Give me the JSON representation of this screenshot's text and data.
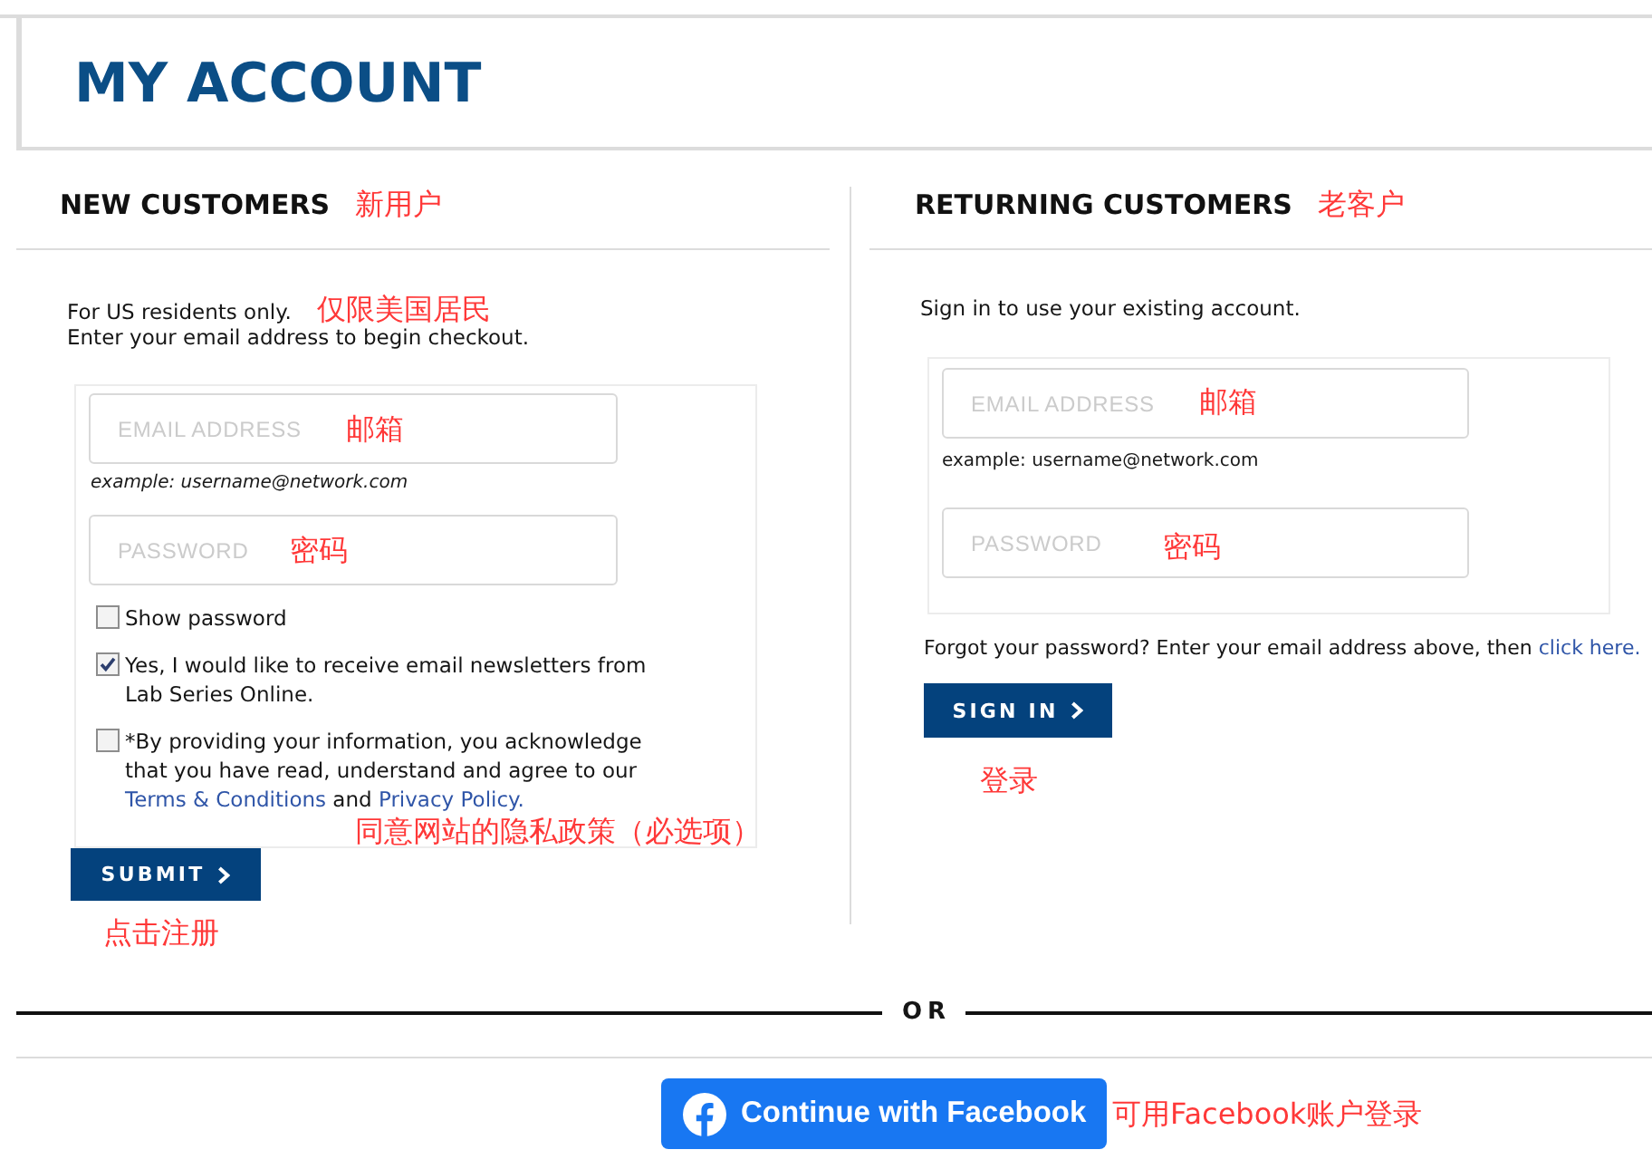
{
  "header": {
    "title": "MY ACCOUNT"
  },
  "new_customers": {
    "heading": "NEW CUSTOMERS",
    "heading_note": "新用户",
    "intro": [
      {
        "text": "For US residents only.",
        "note": "仅限美国居民"
      },
      {
        "text": "Enter your email address to begin checkout."
      }
    ],
    "fields": [
      {
        "placeholder": "EMAIL ADDRESS",
        "note": "邮箱",
        "hint": "example: username@network.com"
      },
      {
        "placeholder": "PASSWORD",
        "note": "密码"
      }
    ],
    "options": [
      {
        "checked": false,
        "label": [
          {
            "kind": "text",
            "text": "Show password"
          }
        ]
      },
      {
        "checked": true,
        "label": [
          {
            "kind": "text",
            "text": "Yes, I would like to receive email newsletters from Lab Series Online."
          }
        ]
      },
      {
        "checked": false,
        "label": [
          {
            "kind": "text",
            "text": "*By providing your information, you acknowledge that you have read, understand and agree to our "
          },
          {
            "kind": "link",
            "text": "Terms & Conditions"
          },
          {
            "kind": "text",
            "text": " and "
          },
          {
            "kind": "link",
            "text": "Privacy Policy."
          }
        ]
      }
    ],
    "consent_note": "同意网站的隐私政策（必选项）",
    "button": "SUBMIT",
    "button_note": "点击注册"
  },
  "returning_customers": {
    "heading": "RETURNING CUSTOMERS",
    "heading_note": "老客户",
    "intro": [
      {
        "text": "Sign in to use your existing account."
      }
    ],
    "fields": [
      {
        "placeholder": "EMAIL ADDRESS",
        "note": "邮箱",
        "hint": "example: username@network.com"
      },
      {
        "placeholder": "PASSWORD",
        "note": "密码"
      }
    ],
    "forgot": [
      {
        "kind": "text",
        "text": "Forgot your password? Enter your email address above, then "
      },
      {
        "kind": "link",
        "text": "click here."
      }
    ],
    "button": "SIGN IN",
    "button_note": "登录"
  },
  "separator": {
    "label": "OR"
  },
  "facebook": {
    "button": "Continue with Facebook",
    "note": "可用Facebook账户登录"
  }
}
